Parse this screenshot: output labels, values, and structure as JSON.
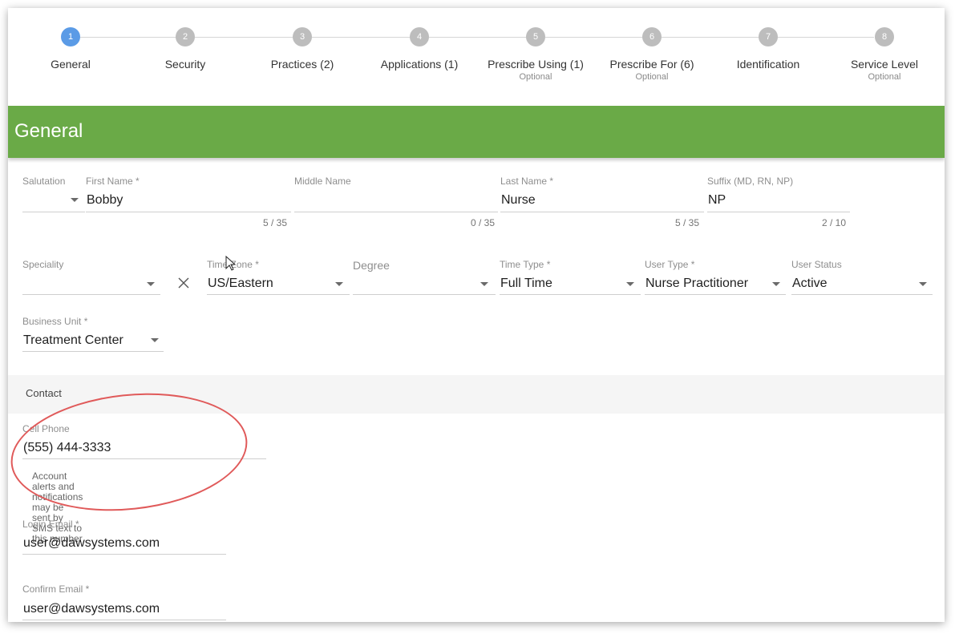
{
  "stepper": {
    "steps": [
      {
        "num": "1",
        "label": "General",
        "sub": ""
      },
      {
        "num": "2",
        "label": "Security",
        "sub": ""
      },
      {
        "num": "3",
        "label": "Practices (2)",
        "sub": ""
      },
      {
        "num": "4",
        "label": "Applications (1)",
        "sub": ""
      },
      {
        "num": "5",
        "label": "Prescribe Using (1)",
        "sub": "Optional"
      },
      {
        "num": "6",
        "label": "Prescribe For (6)",
        "sub": "Optional"
      },
      {
        "num": "7",
        "label": "Identification",
        "sub": ""
      },
      {
        "num": "8",
        "label": "Service Level",
        "sub": "Optional"
      }
    ],
    "active_step": 1
  },
  "section_title": "General",
  "name_row": {
    "salutation": {
      "label": "Salutation",
      "value": ""
    },
    "first_name": {
      "label": "First Name *",
      "value": "Bobby",
      "counter": "5 / 35"
    },
    "middle_name": {
      "label": "Middle Name",
      "value": "",
      "counter": "0 / 35"
    },
    "last_name": {
      "label": "Last Name *",
      "value": "Nurse",
      "counter": "5 / 35"
    },
    "suffix": {
      "label": "Suffix (MD, RN, NP)",
      "value": "NP",
      "counter": "2 / 10"
    }
  },
  "detail_row": {
    "speciality": {
      "label": "Speciality",
      "value": ""
    },
    "time_zone": {
      "label": "Time Zone *",
      "value": "US/Eastern"
    },
    "degree": {
      "label": "Degree",
      "value": ""
    },
    "time_type": {
      "label": "Time Type *",
      "value": "Full Time"
    },
    "user_type": {
      "label": "User Type *",
      "value": "Nurse Practitioner"
    },
    "user_status": {
      "label": "User Status",
      "value": "Active"
    }
  },
  "business_unit": {
    "label": "Business Unit *",
    "value": "Treatment Center"
  },
  "contact": {
    "heading": "Contact",
    "cell_phone": {
      "label": "Cell Phone",
      "value": "(555) 444-3333",
      "hint_line1": "Account alerts and notifications may be sent by",
      "hint_line2": "SMS text to this number"
    },
    "login_email": {
      "label": "Login Email *",
      "value": "user@dawsystems.com"
    },
    "confirm_email": {
      "label": "Confirm Email *",
      "value": "user@dawsystems.com"
    }
  },
  "colors": {
    "band": "#6aaa47",
    "active_step": "#5b9be6",
    "annotation": "#e05a5a"
  },
  "icons": {
    "clear": "close-icon",
    "dropdown": "caret-down-icon"
  }
}
